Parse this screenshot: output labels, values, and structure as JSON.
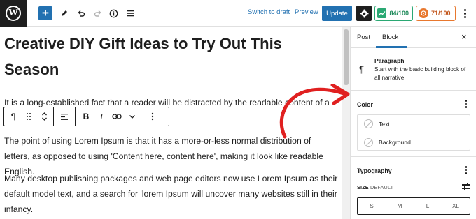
{
  "topbar": {
    "plus_label": "+",
    "switch_to_draft": "Switch to draft",
    "preview": "Preview",
    "update": "Update",
    "seo_score": "84/100",
    "readability_score": "71/100",
    "icons": [
      "wordpress-logo-icon",
      "add-block-icon",
      "pencil-icon",
      "undo-icon",
      "redo-icon",
      "info-icon",
      "list-view-icon",
      "gear-icon",
      "more-icon"
    ]
  },
  "editor": {
    "title": "Creative DIY Gift Ideas to Try Out This Season",
    "paragraphs": [
      "It is a long-established fact that a reader will be distracted by the readable content of a",
      "The point of using Lorem Ipsum is that it has a more-or-less normal distribution of letters, as opposed to using 'Content here, content here', making it look like readable English.",
      "Many desktop publishing packages and web page editors now use Lorem Ipsum as their default model text, and a search for 'lorem Ipsum will uncover many websites still in their infancy."
    ],
    "block_toolbar": {
      "paragraph_symbol": "¶",
      "bold": "B",
      "italic": "I"
    }
  },
  "sidebar": {
    "tabs": [
      "Post",
      "Block"
    ],
    "active_tab": "Block",
    "close_symbol": "×",
    "block_card": {
      "icon_symbol": "¶",
      "title": "Paragraph",
      "description": "Start with the basic building block of all narrative."
    },
    "color": {
      "heading": "Color",
      "options": [
        "Text",
        "Background"
      ]
    },
    "typography": {
      "heading": "Typography",
      "size_label": "SIZE",
      "size_value": "DEFAULT",
      "sizes": [
        "S",
        "M",
        "L",
        "XL"
      ]
    }
  },
  "colors": {
    "accent": "#2271b1",
    "seo_green": "#2aa873",
    "readability_orange": "#e8782e",
    "arrow_red": "#e02020"
  }
}
